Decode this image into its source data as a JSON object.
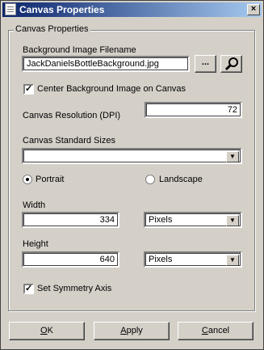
{
  "window": {
    "title": "Canvas Properties",
    "close_glyph": "×"
  },
  "group": {
    "label": "Canvas Properties"
  },
  "background": {
    "label": "Background Image Filename",
    "value": "JackDanielsBottleBackground.jpg",
    "browse_label": "...",
    "center_label": "Center Background Image on Canvas",
    "center_checked": true
  },
  "resolution": {
    "label": "Canvas Resolution (DPI)",
    "value": "72"
  },
  "standard_sizes": {
    "label": "Canvas Standard Sizes",
    "value": ""
  },
  "orientation": {
    "portrait_label": "Portrait",
    "landscape_label": "Landscape",
    "selected": "Portrait"
  },
  "width": {
    "label": "Width",
    "value": "334",
    "unit": "Pixels"
  },
  "height": {
    "label": "Height",
    "value": "640",
    "unit": "Pixels"
  },
  "symmetry": {
    "label": "Set Symmetry Axis",
    "checked": true
  },
  "buttons": {
    "ok_first": "O",
    "ok_rest": "K",
    "apply_first": "A",
    "apply_rest": "pply",
    "cancel_first": "C",
    "cancel_rest": "ancel"
  },
  "check_glyph": "✓"
}
